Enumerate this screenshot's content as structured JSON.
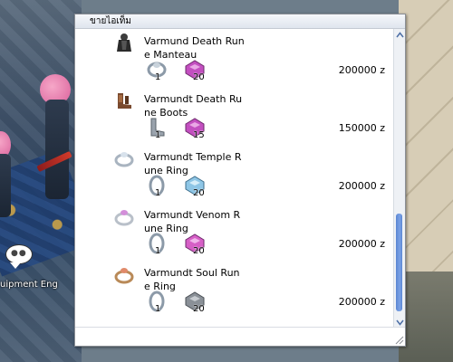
{
  "window": {
    "title": "ขายไอเท็ม"
  },
  "items": [
    {
      "name": "Varmund Death Rune Manteau",
      "price": "200000 z",
      "icon": "manteau-icon",
      "materials": [
        {
          "icon": "ring-material-icon",
          "count": "1"
        },
        {
          "icon": "gem-material-icon",
          "count": "20"
        }
      ]
    },
    {
      "name": "Varmundt Death Rune Boots",
      "price": "150000 z",
      "icon": "boots-icon",
      "materials": [
        {
          "icon": "boots-material-icon",
          "count": "1"
        },
        {
          "icon": "gem-material-icon",
          "count": "15"
        }
      ]
    },
    {
      "name": "Varmundt Temple Rune Ring",
      "price": "200000 z",
      "icon": "ring-icon",
      "materials": [
        {
          "icon": "ring-material-icon",
          "count": "1"
        },
        {
          "icon": "gem-material-icon",
          "count": "20"
        }
      ]
    },
    {
      "name": "Varmundt Venom Rune Ring",
      "price": "200000 z",
      "icon": "ring-icon",
      "materials": [
        {
          "icon": "ring-material-icon",
          "count": "1"
        },
        {
          "icon": "gem-material-icon",
          "count": "20"
        }
      ]
    },
    {
      "name": "Varmundt Soul Rune Ring",
      "price": "200000 z",
      "icon": "ring-icon",
      "materials": [
        {
          "icon": "ring-material-icon",
          "count": "1"
        },
        {
          "icon": "gem-material-icon",
          "count": "20"
        }
      ]
    }
  ],
  "background": {
    "npc_label": "uipment Eng"
  },
  "colors": {
    "scroll_thumb": "#6a94dc",
    "gem_pink": "#c34fc0",
    "gem_blue": "#8ec6e6",
    "gem_gray": "#8a9097"
  }
}
